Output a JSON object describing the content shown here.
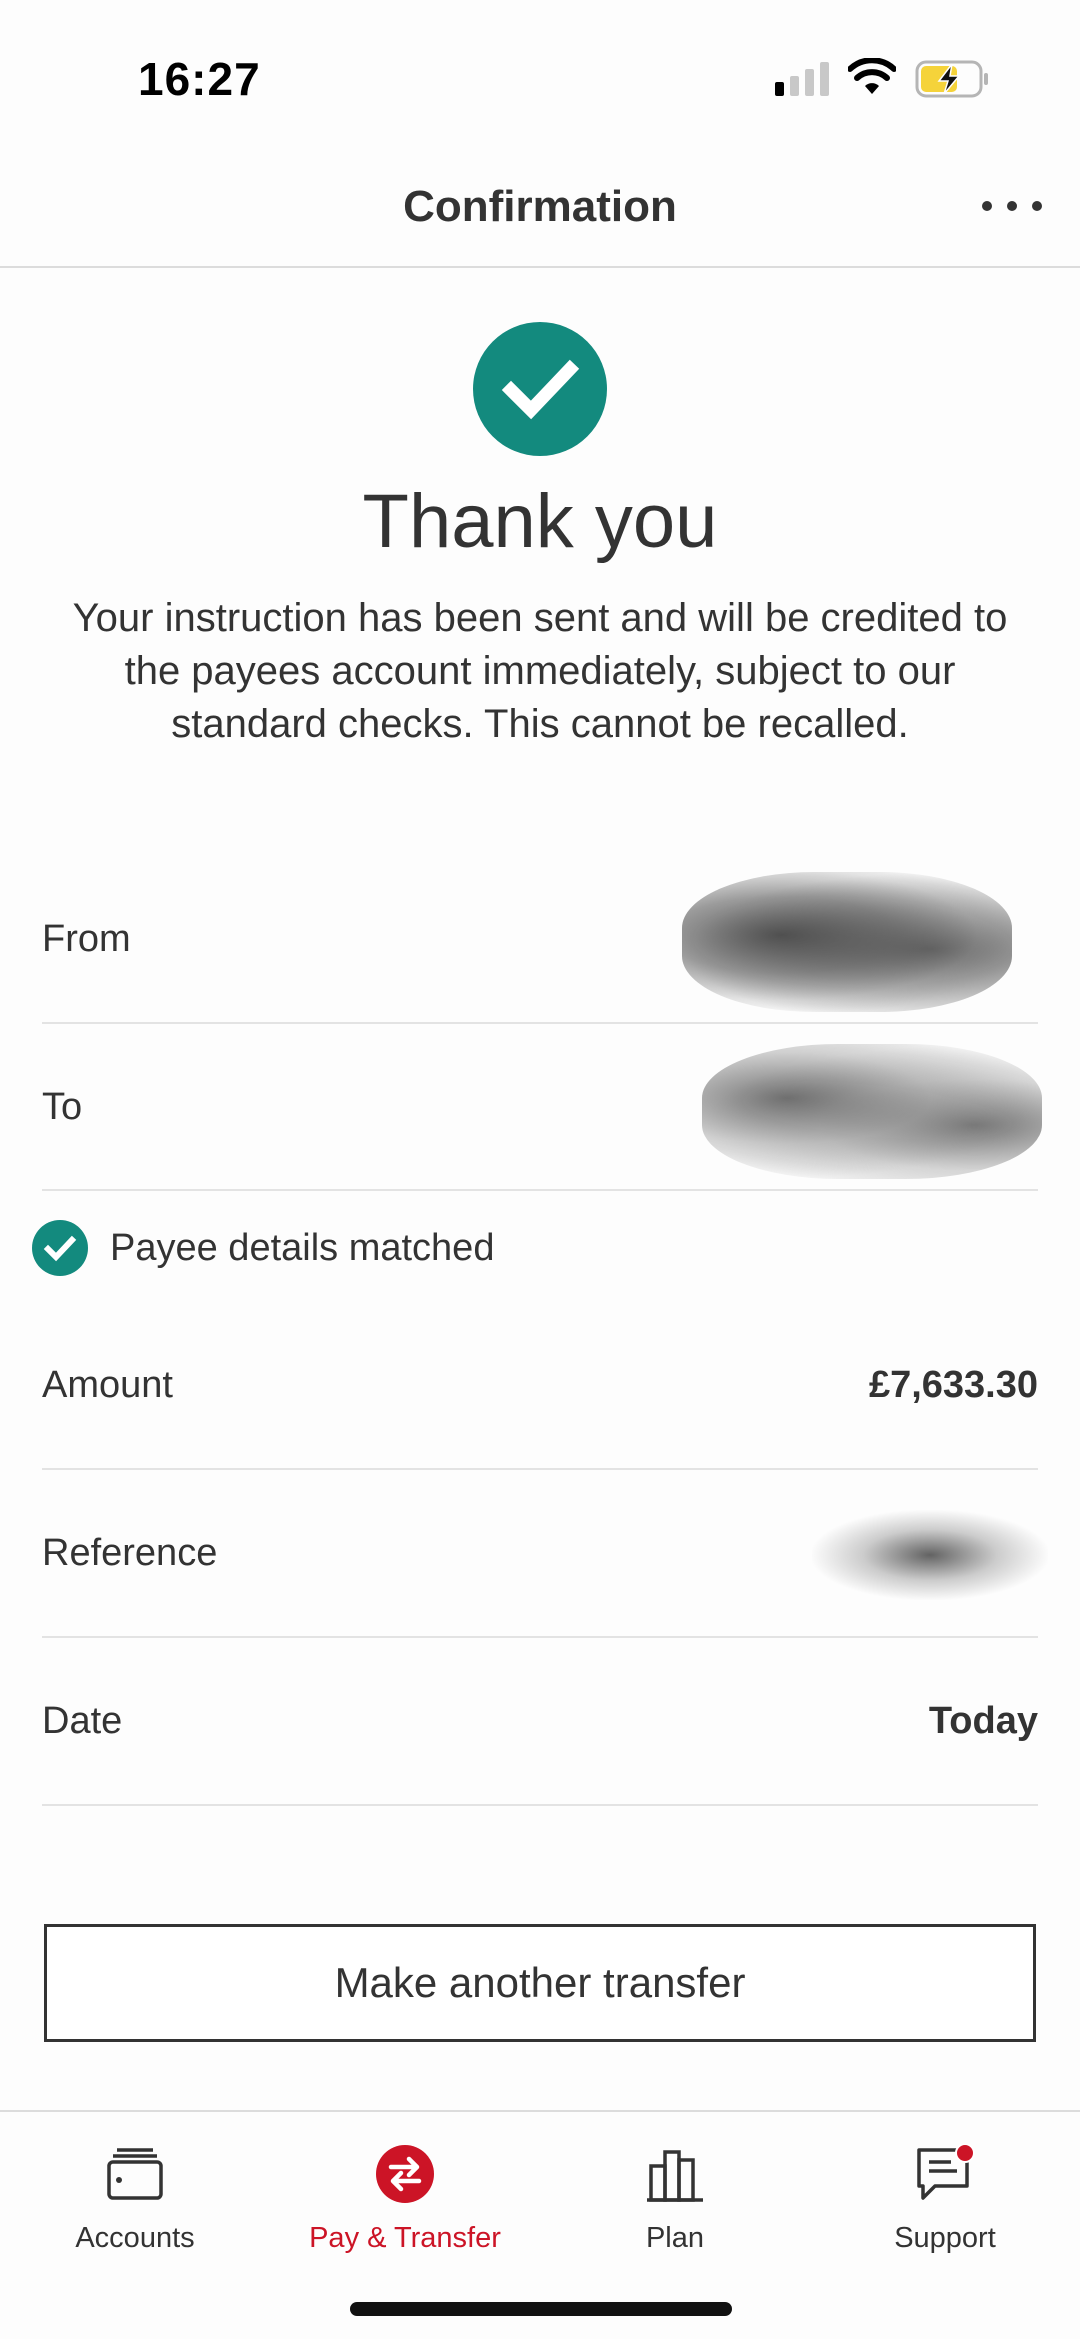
{
  "status_bar": {
    "time": "16:27",
    "icons": [
      "cellular-signal-icon",
      "wifi-icon",
      "battery-charging-icon"
    ],
    "battery_color": "#f5d33a"
  },
  "header": {
    "title": "Confirmation",
    "more_icon": "more-horizontal-icon"
  },
  "success": {
    "icon": "check-circle-icon",
    "title": "Thank you",
    "message": "Your instruction has been sent and will be credited to the payees account immediately, subject to our standard checks.  This cannot be recalled."
  },
  "details": {
    "from_label": "From",
    "to_label": "To",
    "payee_matched": "Payee details matched",
    "amount_label": "Amount",
    "amount_value": "£7,633.30",
    "reference_label": "Reference",
    "date_label": "Date",
    "date_value": "Today"
  },
  "actions": {
    "make_another_transfer": "Make another transfer"
  },
  "tab_bar": {
    "tabs": [
      {
        "label": "Accounts",
        "icon": "wallet-icon",
        "active": false
      },
      {
        "label": "Pay & Transfer",
        "icon": "transfer-arrows-icon",
        "active": true
      },
      {
        "label": "Plan",
        "icon": "bar-chart-icon",
        "active": false
      },
      {
        "label": "Support",
        "icon": "chat-notification-icon",
        "active": false
      }
    ]
  },
  "colors": {
    "accent_green": "#138a7e",
    "brand_red": "#cc1426",
    "text": "#333333"
  }
}
